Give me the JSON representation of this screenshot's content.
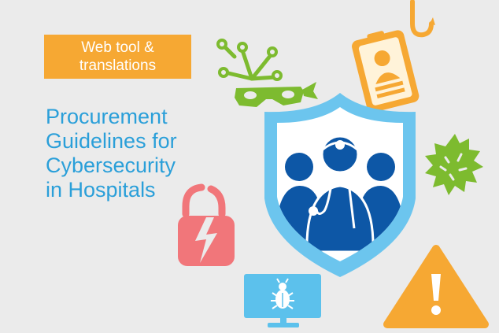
{
  "badge": {
    "line1": "Web tool &",
    "line2": "translations"
  },
  "title": {
    "line1": "Procurement",
    "line2": "Guidelines for",
    "line3": "Cybersecurity",
    "line4": "in Hospitals"
  },
  "colors": {
    "background": "#ebebeb",
    "badge": "#f6a833",
    "title": "#2a9fd9",
    "shield_outer": "#6cc5ee",
    "shield_inner": "#0d57a6",
    "network_mask": "#7dbb2f",
    "phishing_card": "#f6a833",
    "virus": "#7dbb2f",
    "broken_lock": "#f1767a",
    "monitor": "#5cc1ec",
    "warning": "#f6a833"
  },
  "icons": [
    "network-mask-icon",
    "phishing-hook-id-card-icon",
    "virus-icon",
    "broken-lock-icon",
    "medical-team-shield-icon",
    "infected-monitor-icon",
    "warning-triangle-icon"
  ]
}
